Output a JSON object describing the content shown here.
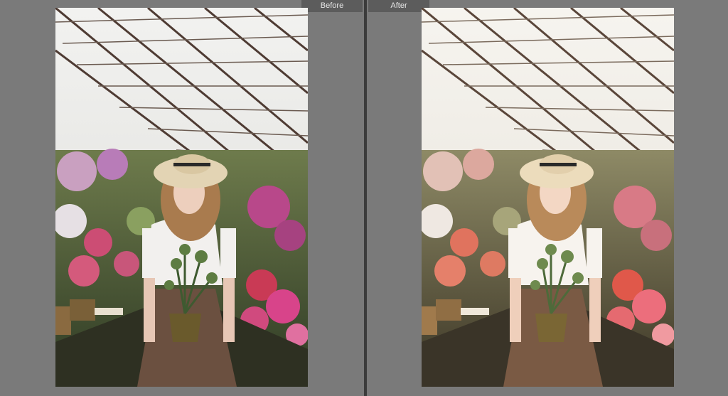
{
  "labels": {
    "before": "Before",
    "after": "After"
  },
  "colors": {
    "background": "#7a7a7a",
    "tab_bg": "#5c5c5c",
    "tab_text": "#e6e6e6",
    "divider": "#3b3b3b"
  }
}
